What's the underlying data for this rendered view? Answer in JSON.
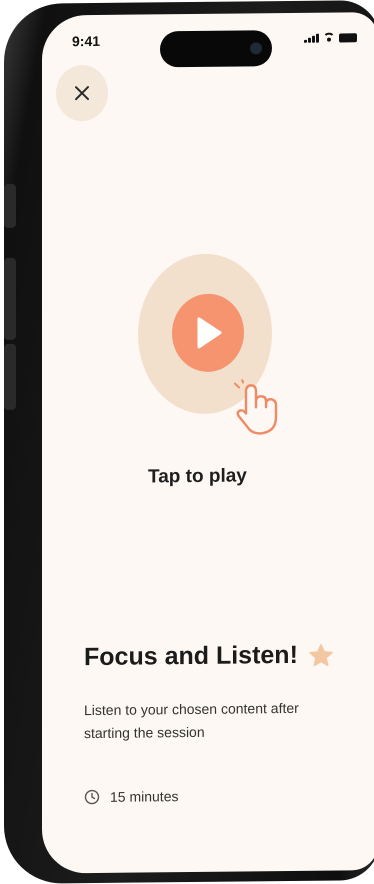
{
  "status_bar": {
    "time": "9:41",
    "icons": [
      "signal-icon",
      "wifi-icon",
      "battery-icon"
    ]
  },
  "header": {
    "close_icon": "close-icon"
  },
  "player": {
    "play_icon": "play-icon",
    "hand_icon": "tap-hand-icon",
    "label": "Tap to play"
  },
  "session": {
    "title": "Focus and Listen!",
    "title_icon": "star-icon",
    "description": "Listen to your chosen content after starting the session",
    "duration_icon": "clock-icon",
    "duration": "15 minutes"
  },
  "colors": {
    "background": "#fdf8f3",
    "accent": "#f5946f",
    "accent_soft": "#f3e0cc",
    "star": "#f4c7a3",
    "close_bg": "#f3e8da"
  }
}
